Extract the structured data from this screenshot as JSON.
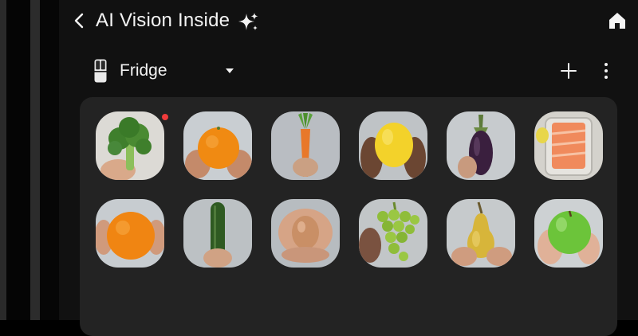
{
  "app": {
    "title": "AI Vision Inside"
  },
  "device": {
    "name": "Fridge"
  },
  "icons": {
    "back": "chevron-left-icon",
    "sparkle": "sparkle-icon",
    "home": "home-icon",
    "fridge": "fridge-icon",
    "dropdown": "caret-down-icon",
    "add": "plus-icon",
    "more": "more-vertical-icon"
  },
  "colors": {
    "background": "#111111",
    "panel": "#232323",
    "text": "#f4f4f4",
    "notification_dot": "#ef3b3b"
  },
  "food_items": [
    {
      "item": "broccoli",
      "new": true
    },
    {
      "item": "orange",
      "new": false
    },
    {
      "item": "carrot",
      "new": false
    },
    {
      "item": "lemon",
      "new": false
    },
    {
      "item": "eggplant",
      "new": false
    },
    {
      "item": "salmon",
      "new": false
    },
    {
      "item": "orange",
      "new": false
    },
    {
      "item": "cucumber",
      "new": false
    },
    {
      "item": "egg",
      "new": false
    },
    {
      "item": "grapes",
      "new": false
    },
    {
      "item": "pear",
      "new": false
    },
    {
      "item": "apple",
      "new": false
    }
  ]
}
